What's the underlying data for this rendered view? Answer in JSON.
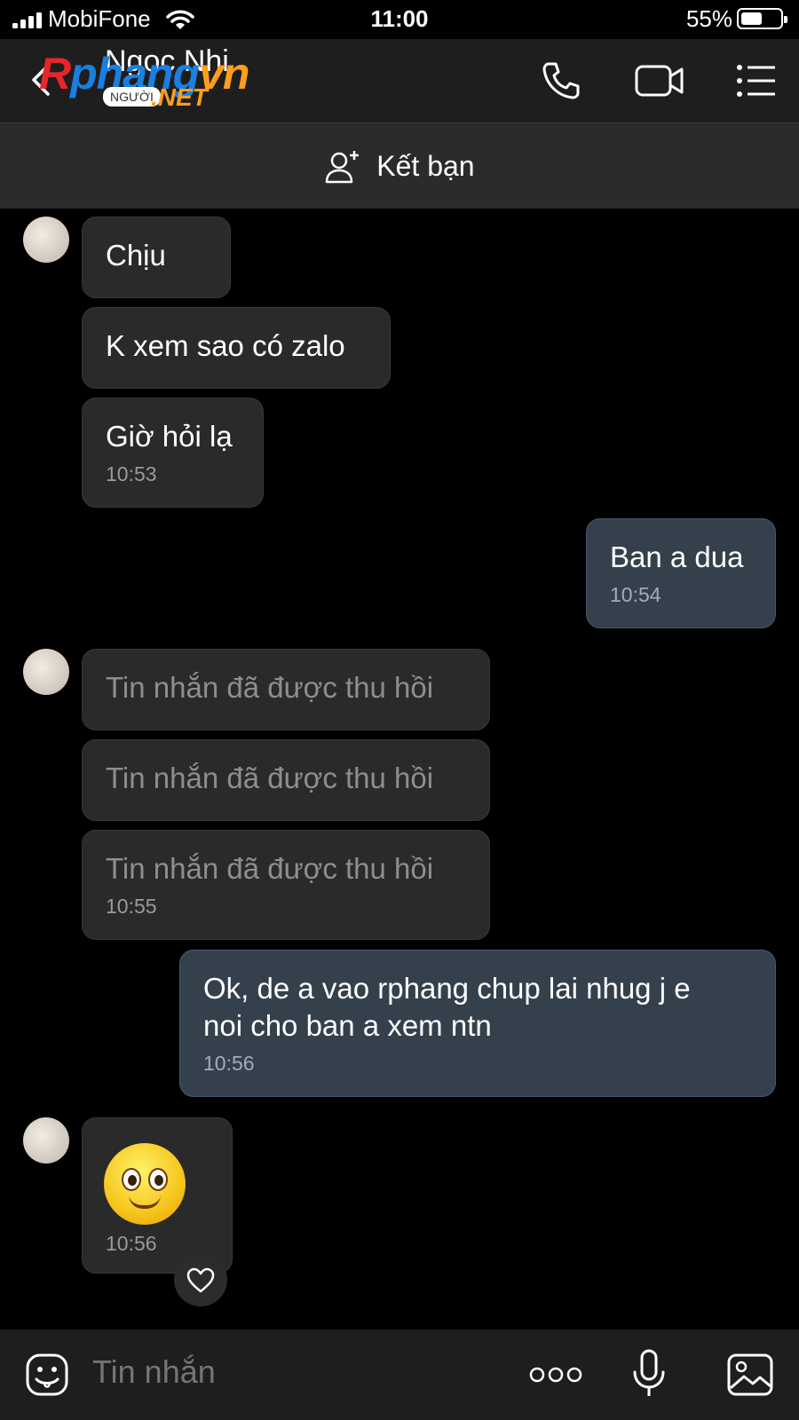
{
  "status_bar": {
    "carrier": "MobiFone",
    "time": "11:00",
    "battery": "55%",
    "battery_level": 0.55
  },
  "header": {
    "contact_name": "Ngoc Nhi",
    "back_icon": "chevron-left-icon",
    "call_icon": "phone-icon",
    "video_icon": "video-camera-icon",
    "menu_icon": "list-menu-icon"
  },
  "watermark": {
    "brand_r": "R",
    "brand_phang": "phang",
    "brand_vn": "vn",
    "tag": "NGƯỜI",
    "net": ".NET",
    "colors": {
      "red": "#e8262a",
      "blue": "#1a7fe0",
      "orange": "#ff9e1a"
    }
  },
  "friend_bar": {
    "label": "Kết bạn",
    "icon": "add-friend-icon"
  },
  "messages": [
    {
      "side": "in",
      "text": "Chịu"
    },
    {
      "side": "in",
      "text": "K xem sao có zalo"
    },
    {
      "side": "in",
      "text": "Giờ hỏi lạ",
      "time": "10:53"
    },
    {
      "side": "out",
      "text": "Ban a dua",
      "time": "10:54"
    },
    {
      "side": "in",
      "text": "Tin nhắn đã được thu hồi",
      "recalled": true
    },
    {
      "side": "in",
      "text": "Tin nhắn đã được thu hồi",
      "recalled": true
    },
    {
      "side": "in",
      "text": "Tin nhắn đã được thu hồi",
      "recalled": true,
      "time": "10:55"
    },
    {
      "side": "out",
      "text": "Ok, de a vao rphang chup lai nhug j e\nnoi cho ban a xem ntn",
      "time": "10:56"
    },
    {
      "side": "in",
      "emoji": "smiling-face-emoji",
      "time": "10:56"
    }
  ],
  "composer": {
    "placeholder": "Tin nhắn",
    "sticker_icon": "sticker-icon",
    "more_icon": "more-dots-icon",
    "mic_icon": "microphone-icon",
    "image_icon": "image-icon"
  },
  "colors": {
    "background": "#000000",
    "incoming_bubble": "#2a2a2a",
    "outgoing_bubble": "#35404d",
    "recalled_text": "#8e8e8e"
  }
}
